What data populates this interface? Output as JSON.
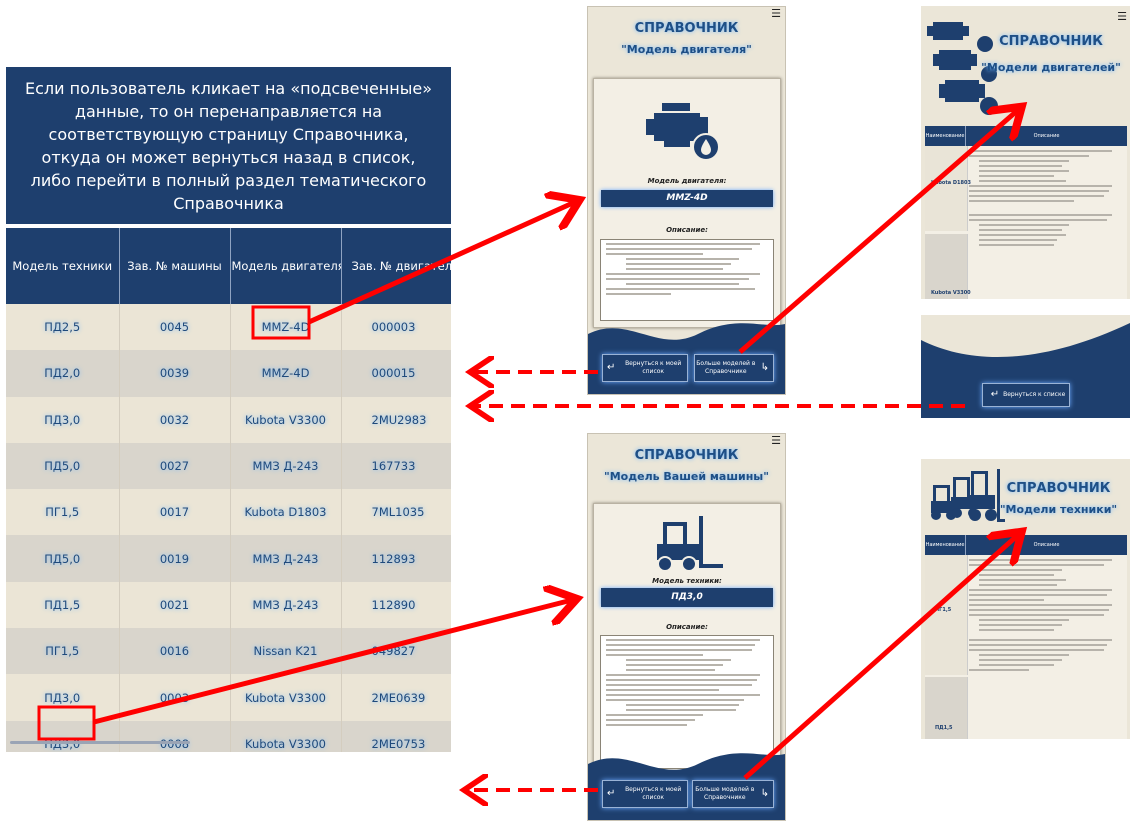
{
  "caption": "Если пользователь кликает на «подсвеченные» данные, то он перенаправляется на соответствующую страницу Справочника, откуда он может вернуться назад в список, либо перейти в полный раздел тематического Справочника",
  "table": {
    "headers": [
      "Модель техники",
      "Зав. № машины",
      "Модель двигателя",
      "Зав. № двигателя"
    ],
    "rows": [
      [
        "ПД2,5",
        "0045",
        "MMZ-4D",
        "000003"
      ],
      [
        "ПД2,0",
        "0039",
        "MMZ-4D",
        "000015"
      ],
      [
        "ПД3,0",
        "0032",
        "Kubota V3300",
        "2MU2983"
      ],
      [
        "ПД5,0",
        "0027",
        "ММЗ Д-243",
        "167733"
      ],
      [
        "ПГ1,5",
        "0017",
        "Kubota D1803",
        "7ML1035"
      ],
      [
        "ПД5,0",
        "0019",
        "ММЗ Д-243",
        "112893"
      ],
      [
        "ПД1,5",
        "0021",
        "ММЗ Д-243",
        "112890"
      ],
      [
        "ПГ1,5",
        "0016",
        "Nissan K21",
        "049827"
      ],
      [
        "ПД3,0",
        "0003",
        "Kubota V3300",
        "2ME0639"
      ],
      [
        "ПД3,0",
        "0008",
        "Kubota V3300",
        "2ME0753"
      ]
    ]
  },
  "engine_page": {
    "title": "СПРАВОЧНИК",
    "subtitle": "\"Модель двигателя\"",
    "field_label": "Модель двигателя:",
    "field_value": "MMZ-4D",
    "desc_label": "Описание:",
    "back_button": "Вернуться к моей список",
    "more_button": "Больше моделей в Справочнике"
  },
  "machine_page": {
    "title": "СПРАВОЧНИК",
    "subtitle": "\"Модель Вашей машины\"",
    "field_label": "Модель техники:",
    "field_value": "ПД3,0",
    "desc_label": "Описание:",
    "back_button": "Вернуться к моей список",
    "more_button": "Больше моделей в Справочнике"
  },
  "engines_dir": {
    "title": "СПРАВОЧНИК",
    "subtitle": "\"Модели двигателей\"",
    "col1": "Наименование",
    "col2": "Описание",
    "row1": "Kubota D1803",
    "row2": "Kubota V3300"
  },
  "engines_dir_bottom": {
    "back_button": "Вернуться к списке"
  },
  "machines_dir": {
    "title": "СПРАВОЧНИК",
    "subtitle": "\"Модели техники\"",
    "col1": "Наименование",
    "col2": "Описание",
    "row1": "ПГ1,5",
    "row2": "ПД1,5"
  },
  "colors": {
    "navy": "#1e3f6e",
    "arrow": "#ff0000",
    "beige": "#ebe6d8"
  },
  "icons": [
    "engine-icon",
    "forklift-icon",
    "menu-icon",
    "enter-icon"
  ]
}
